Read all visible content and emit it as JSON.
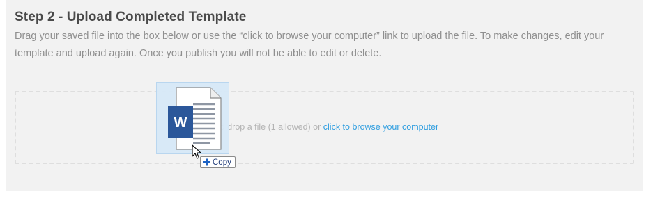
{
  "step": {
    "title": "Step 2 - Upload Completed Template",
    "instructions": "Drag your saved file into the box below or use the “click to browse your computer” link to upload the file. To make changes, edit your template and upload again. Once you publish you will not be able to edit or delete."
  },
  "dropzone": {
    "text_partial": "and drop a file (1 allowed) or ",
    "browse_link": "click to browse your computer"
  },
  "drag_ghost": {
    "icon": "word-document-icon",
    "badge_letter": "W"
  },
  "drag_tooltip": {
    "label": "Copy",
    "icon": "plus-icon"
  },
  "colors": {
    "panel_background": "#f2f2f2",
    "title_text": "#4a4a4a",
    "body_text": "#8f8f8f",
    "link": "#2f9ee0",
    "word_blue": "#2b579a"
  }
}
